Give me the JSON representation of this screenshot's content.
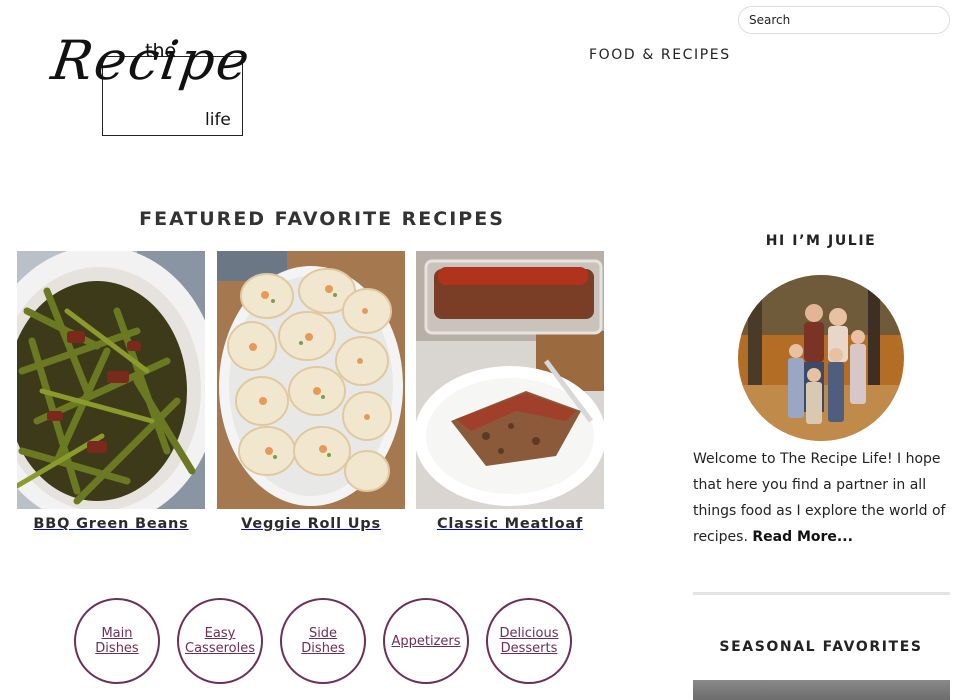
{
  "header": {
    "search_placeholder": "Search",
    "logo": {
      "the": "the",
      "recipe": "Recipe",
      "life": "life"
    },
    "nav": {
      "food_recipes": "FOOD & RECIPES"
    }
  },
  "featured": {
    "title": "FEATURED FAVORITE RECIPES",
    "cards": [
      {
        "title": "BBQ Green Beans"
      },
      {
        "title": "Veggie Roll Ups"
      },
      {
        "title": "Classic Meatloaf"
      }
    ]
  },
  "categories": [
    {
      "label": "Main\nDishes"
    },
    {
      "label": "Easy\nCasseroles"
    },
    {
      "label": "Side\nDishes"
    },
    {
      "label": "Appetizers"
    },
    {
      "label": "Delicious\nDesserts"
    }
  ],
  "sidebar": {
    "hi_heading": "HI I’M JULIE",
    "bio_text": "Welcome to The Recipe Life! I hope that here you find a partner in all things food as I explore the world of recipes.",
    "read_more": "Read More...",
    "seasonal_heading": "SEASONAL FAVORITES"
  },
  "colors": {
    "accent": "#6a3058",
    "divider": "#e4e4e4"
  }
}
